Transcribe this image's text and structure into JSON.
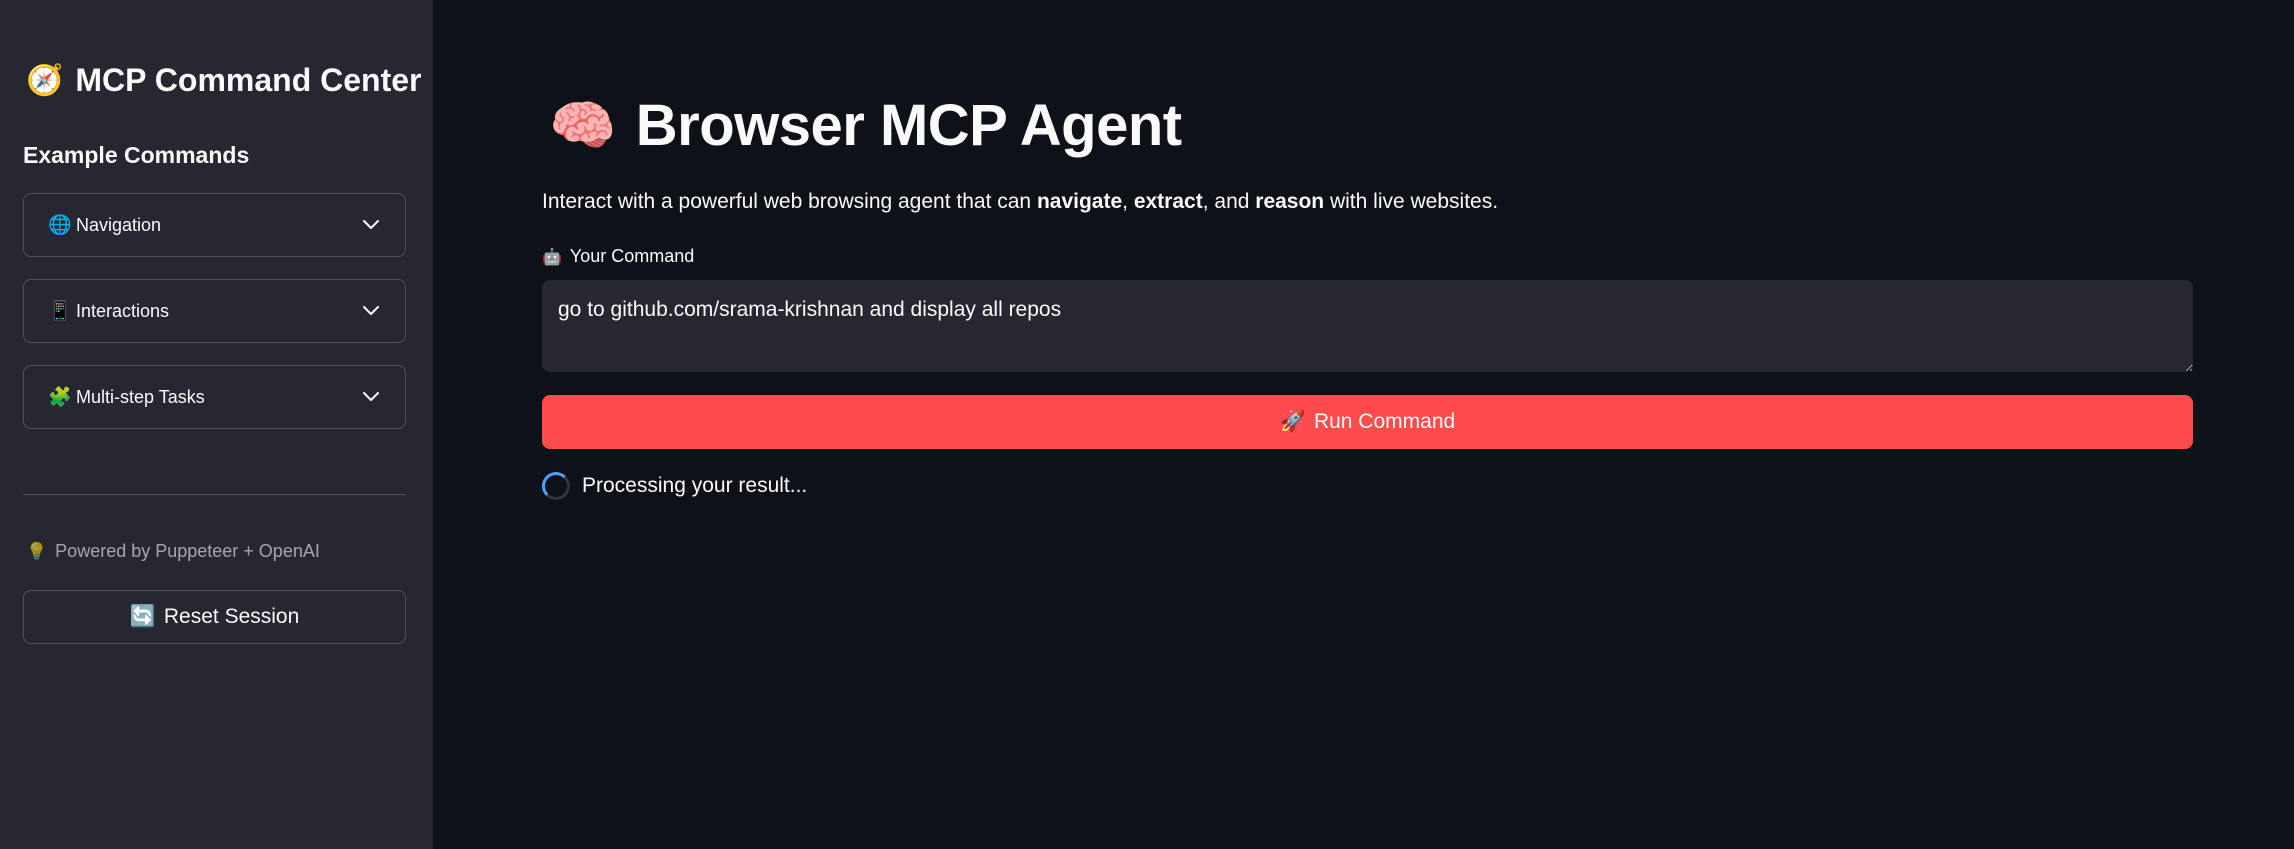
{
  "sidebar": {
    "title_icon": "compass-icon",
    "title_emoji": "🧭",
    "title": "MCP Command Center",
    "subtitle": "Example Commands",
    "expanders": [
      {
        "emoji": "🌐",
        "icon": "globe-icon",
        "label": "Navigation"
      },
      {
        "emoji": "📱",
        "icon": "phone-icon",
        "label": "Interactions"
      },
      {
        "emoji": "🧩",
        "icon": "puzzle-icon",
        "label": "Multi-step Tasks"
      }
    ],
    "powered_emoji": "💡",
    "powered_text": "Powered by Puppeteer + OpenAI",
    "reset_emoji": "🔄",
    "reset_label": "Reset Session"
  },
  "main": {
    "title_emoji": "🧠",
    "title": "Browser MCP Agent",
    "description": {
      "prefix": "Interact with a powerful web browsing agent that can ",
      "bold1": "navigate",
      "sep1": ", ",
      "bold2": "extract",
      "sep2": ", and ",
      "bold3": "reason",
      "suffix": " with live websites."
    },
    "command_label_emoji": "🤖",
    "command_label": "Your Command",
    "command_value": "go to github.com/srama-krishnan and display all repos",
    "run_emoji": "🚀",
    "run_label": "Run Command",
    "status_text": "Processing your result..."
  },
  "colors": {
    "background": "#0e1117",
    "sidebar": "#262730",
    "primary": "#ff4b4b",
    "spinner": "#4da3ff"
  }
}
